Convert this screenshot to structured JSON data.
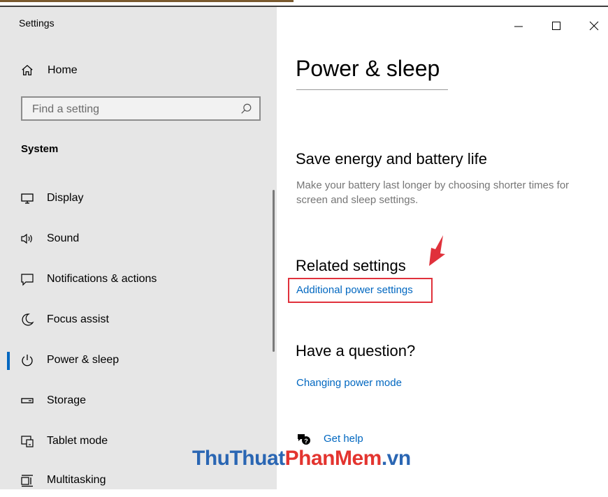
{
  "window": {
    "app_title": "Settings",
    "controls": {
      "minimize": "minimize-icon",
      "maximize": "maximize-icon",
      "close": "close-icon"
    }
  },
  "sidebar": {
    "home_label": "Home",
    "search_placeholder": "Find a setting",
    "section_title": "System",
    "items": [
      {
        "label": "Display",
        "icon": "display-icon"
      },
      {
        "label": "Sound",
        "icon": "sound-icon"
      },
      {
        "label": "Notifications & actions",
        "icon": "notifications-icon"
      },
      {
        "label": "Focus assist",
        "icon": "focus-assist-icon"
      },
      {
        "label": "Power & sleep",
        "icon": "power-icon",
        "active": true
      },
      {
        "label": "Storage",
        "icon": "storage-icon"
      },
      {
        "label": "Tablet mode",
        "icon": "tablet-mode-icon"
      },
      {
        "label": "Multitasking",
        "icon": "multitasking-icon"
      }
    ]
  },
  "main": {
    "page_title": "Power & sleep",
    "save_energy": {
      "heading": "Save energy and battery life",
      "description": "Make your battery last longer by choosing shorter times for screen and sleep settings."
    },
    "related": {
      "heading": "Related settings",
      "link": "Additional power settings"
    },
    "question": {
      "heading": "Have a question?",
      "link": "Changing power mode"
    },
    "get_help": "Get help"
  },
  "annotations": {
    "highlight_color": "#e0313b",
    "arrow_color": "#e0313b"
  },
  "watermark": {
    "part1": "ThuThuat",
    "part2": "PhanMem",
    "part3": ".vn"
  },
  "colors": {
    "accent": "#0067c0",
    "sidebar_bg": "#e6e6e6",
    "secondary_text": "#767676"
  }
}
